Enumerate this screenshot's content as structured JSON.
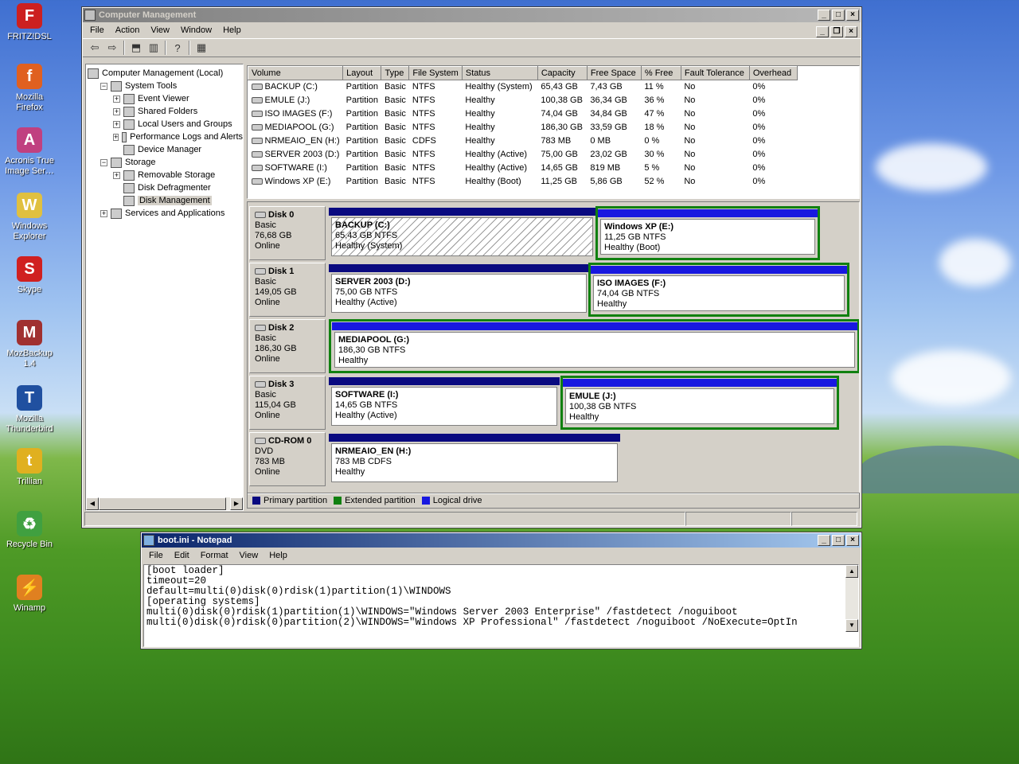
{
  "desktop": {
    "icons": [
      {
        "label": "FRITZ!DSL",
        "color": "#cc2020",
        "glyph": "F"
      },
      {
        "label": "Mozilla Firefox",
        "color": "#e06020",
        "glyph": "f"
      },
      {
        "label": "Acronis True Image Ser…",
        "color": "#c04080",
        "glyph": "A"
      },
      {
        "label": "Windows Explorer",
        "color": "#e0c040",
        "glyph": "W"
      },
      {
        "label": "Skype",
        "color": "#d02020",
        "glyph": "S"
      },
      {
        "label": "MozBackup 1.4",
        "color": "#a03030",
        "glyph": "M"
      },
      {
        "label": "Mozilla Thunderbird",
        "color": "#2050a0",
        "glyph": "T"
      },
      {
        "label": "Trillian",
        "color": "#e0b020",
        "glyph": "t"
      },
      {
        "label": "Recycle Bin",
        "color": "#40a040",
        "glyph": "♻"
      },
      {
        "label": "Winamp",
        "color": "#e08020",
        "glyph": "⚡"
      }
    ]
  },
  "cm": {
    "title": "Computer Management",
    "menu": [
      "File",
      "Action",
      "View",
      "Window",
      "Help"
    ],
    "tree": [
      {
        "label": "Computer Management (Local)",
        "level": 0,
        "exp": ""
      },
      {
        "label": "System Tools",
        "level": 1,
        "exp": "−"
      },
      {
        "label": "Event Viewer",
        "level": 2,
        "exp": "+"
      },
      {
        "label": "Shared Folders",
        "level": 2,
        "exp": "+"
      },
      {
        "label": "Local Users and Groups",
        "level": 2,
        "exp": "+"
      },
      {
        "label": "Performance Logs and Alerts",
        "level": 2,
        "exp": "+"
      },
      {
        "label": "Device Manager",
        "level": 2,
        "exp": ""
      },
      {
        "label": "Storage",
        "level": 1,
        "exp": "−"
      },
      {
        "label": "Removable Storage",
        "level": 2,
        "exp": "+"
      },
      {
        "label": "Disk Defragmenter",
        "level": 2,
        "exp": ""
      },
      {
        "label": "Disk Management",
        "level": 2,
        "exp": "",
        "selected": true
      },
      {
        "label": "Services and Applications",
        "level": 1,
        "exp": "+"
      }
    ],
    "columns": [
      "Volume",
      "Layout",
      "Type",
      "File System",
      "Status",
      "Capacity",
      "Free Space",
      "% Free",
      "Fault Tolerance",
      "Overhead"
    ],
    "rows": [
      [
        "BACKUP (C:)",
        "Partition",
        "Basic",
        "NTFS",
        "Healthy (System)",
        "65,43 GB",
        "7,43 GB",
        "11 %",
        "No",
        "0%"
      ],
      [
        "EMULE (J:)",
        "Partition",
        "Basic",
        "NTFS",
        "Healthy",
        "100,38 GB",
        "36,34 GB",
        "36 %",
        "No",
        "0%"
      ],
      [
        "ISO IMAGES (F:)",
        "Partition",
        "Basic",
        "NTFS",
        "Healthy",
        "74,04 GB",
        "34,84 GB",
        "47 %",
        "No",
        "0%"
      ],
      [
        "MEDIAPOOL (G:)",
        "Partition",
        "Basic",
        "NTFS",
        "Healthy",
        "186,30 GB",
        "33,59 GB",
        "18 %",
        "No",
        "0%"
      ],
      [
        "NRMEAIO_EN (H:)",
        "Partition",
        "Basic",
        "CDFS",
        "Healthy",
        "783 MB",
        "0 MB",
        "0 %",
        "No",
        "0%"
      ],
      [
        "SERVER 2003 (D:)",
        "Partition",
        "Basic",
        "NTFS",
        "Healthy (Active)",
        "75,00 GB",
        "23,02 GB",
        "30 %",
        "No",
        "0%"
      ],
      [
        "SOFTWARE (I:)",
        "Partition",
        "Basic",
        "NTFS",
        "Healthy (Active)",
        "14,65 GB",
        "819 MB",
        "5 %",
        "No",
        "0%"
      ],
      [
        "Windows XP (E:)",
        "Partition",
        "Basic",
        "NTFS",
        "Healthy (Boot)",
        "11,25 GB",
        "5,86 GB",
        "52 %",
        "No",
        "0%"
      ]
    ],
    "disks": [
      {
        "name": "Disk 0",
        "type": "Basic",
        "size": "76,68 GB",
        "state": "Online",
        "parts": [
          {
            "name": "BACKUP  (C:)",
            "size": "65,43 GB NTFS",
            "status": "Healthy (System)",
            "hatched": true
          },
          {
            "name": "Windows XP  (E:)",
            "size": "11,25 GB NTFS",
            "status": "Healthy (Boot)",
            "logical": true
          }
        ]
      },
      {
        "name": "Disk 1",
        "type": "Basic",
        "size": "149,05 GB",
        "state": "Online",
        "parts": [
          {
            "name": "SERVER 2003  (D:)",
            "size": "75,00 GB NTFS",
            "status": "Healthy (Active)"
          },
          {
            "name": "ISO IMAGES  (F:)",
            "size": "74,04 GB NTFS",
            "status": "Healthy",
            "logical": true
          }
        ]
      },
      {
        "name": "Disk 2",
        "type": "Basic",
        "size": "186,30 GB",
        "state": "Online",
        "parts": [
          {
            "name": "MEDIAPOOL  (G:)",
            "size": "186,30 GB NTFS",
            "status": "Healthy",
            "logical": true
          }
        ]
      },
      {
        "name": "Disk 3",
        "type": "Basic",
        "size": "115,04 GB",
        "state": "Online",
        "parts": [
          {
            "name": "SOFTWARE  (I:)",
            "size": "14,65 GB NTFS",
            "status": "Healthy (Active)"
          },
          {
            "name": "EMULE  (J:)",
            "size": "100,38 GB NTFS",
            "status": "Healthy",
            "logical": true
          }
        ]
      },
      {
        "name": "CD-ROM 0",
        "type": "DVD",
        "size": "783 MB",
        "state": "Online",
        "parts": [
          {
            "name": "NRMEAIO_EN  (H:)",
            "size": "783 MB CDFS",
            "status": "Healthy"
          }
        ]
      }
    ],
    "legend": [
      {
        "label": "Primary partition",
        "color": "#0a0a80"
      },
      {
        "label": "Extended partition",
        "color": "#108010"
      },
      {
        "label": "Logical drive",
        "color": "#1818e0"
      }
    ]
  },
  "notepad": {
    "title": "boot.ini - Notepad",
    "menu": [
      "File",
      "Edit",
      "Format",
      "View",
      "Help"
    ],
    "lines": [
      "[boot loader]",
      "timeout=20",
      "default=multi(0)disk(0)rdisk(1)partition(1)\\WINDOWS",
      "[operating systems]",
      "multi(0)disk(0)rdisk(1)partition(1)\\WINDOWS=\"Windows Server 2003 Enterprise\" /fastdetect /noguiboot",
      "multi(0)disk(0)rdisk(0)partition(2)\\WINDOWS=\"Windows XP Professional\" /fastdetect /noguiboot /NoExecute=OptIn"
    ]
  }
}
